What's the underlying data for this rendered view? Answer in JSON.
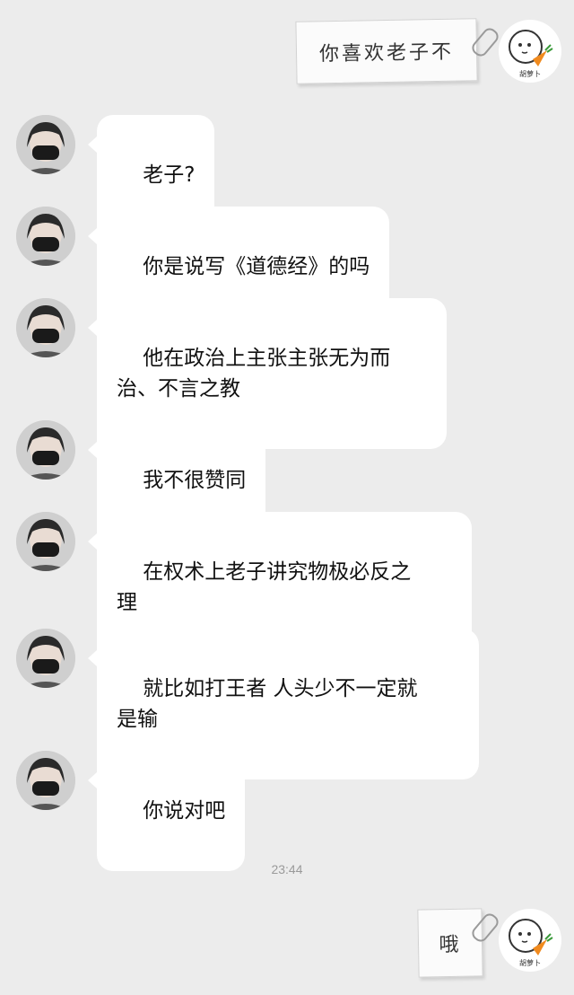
{
  "conversation": {
    "outgoing_top": {
      "text": "你喜欢老子不",
      "avatar_label": "胡萝卜"
    },
    "incoming": [
      {
        "text": "老子?"
      },
      {
        "text": "你是说写《道德经》的吗"
      },
      {
        "text": "他在政治上主张主张无为而\n治、不言之教"
      },
      {
        "text": "我不很赞同"
      },
      {
        "text": "在权术上老子讲究物极必反之\n理"
      },
      {
        "text": "就比如打王者 人头少不一定就\n是输"
      },
      {
        "text": "你说对吧"
      }
    ],
    "timestamp": "23:44",
    "outgoing_bottom": {
      "text": "哦",
      "avatar_label": "胡萝卜"
    }
  },
  "colors": {
    "background": "#ececec",
    "bubble": "#ffffff",
    "carrot": "#f08a1e",
    "leaf": "#3a9a3a"
  },
  "icons": {
    "incoming_avatar": "masked-person-photo",
    "self_avatar": "carrot-character-icon",
    "paperclip": "paperclip-icon"
  }
}
